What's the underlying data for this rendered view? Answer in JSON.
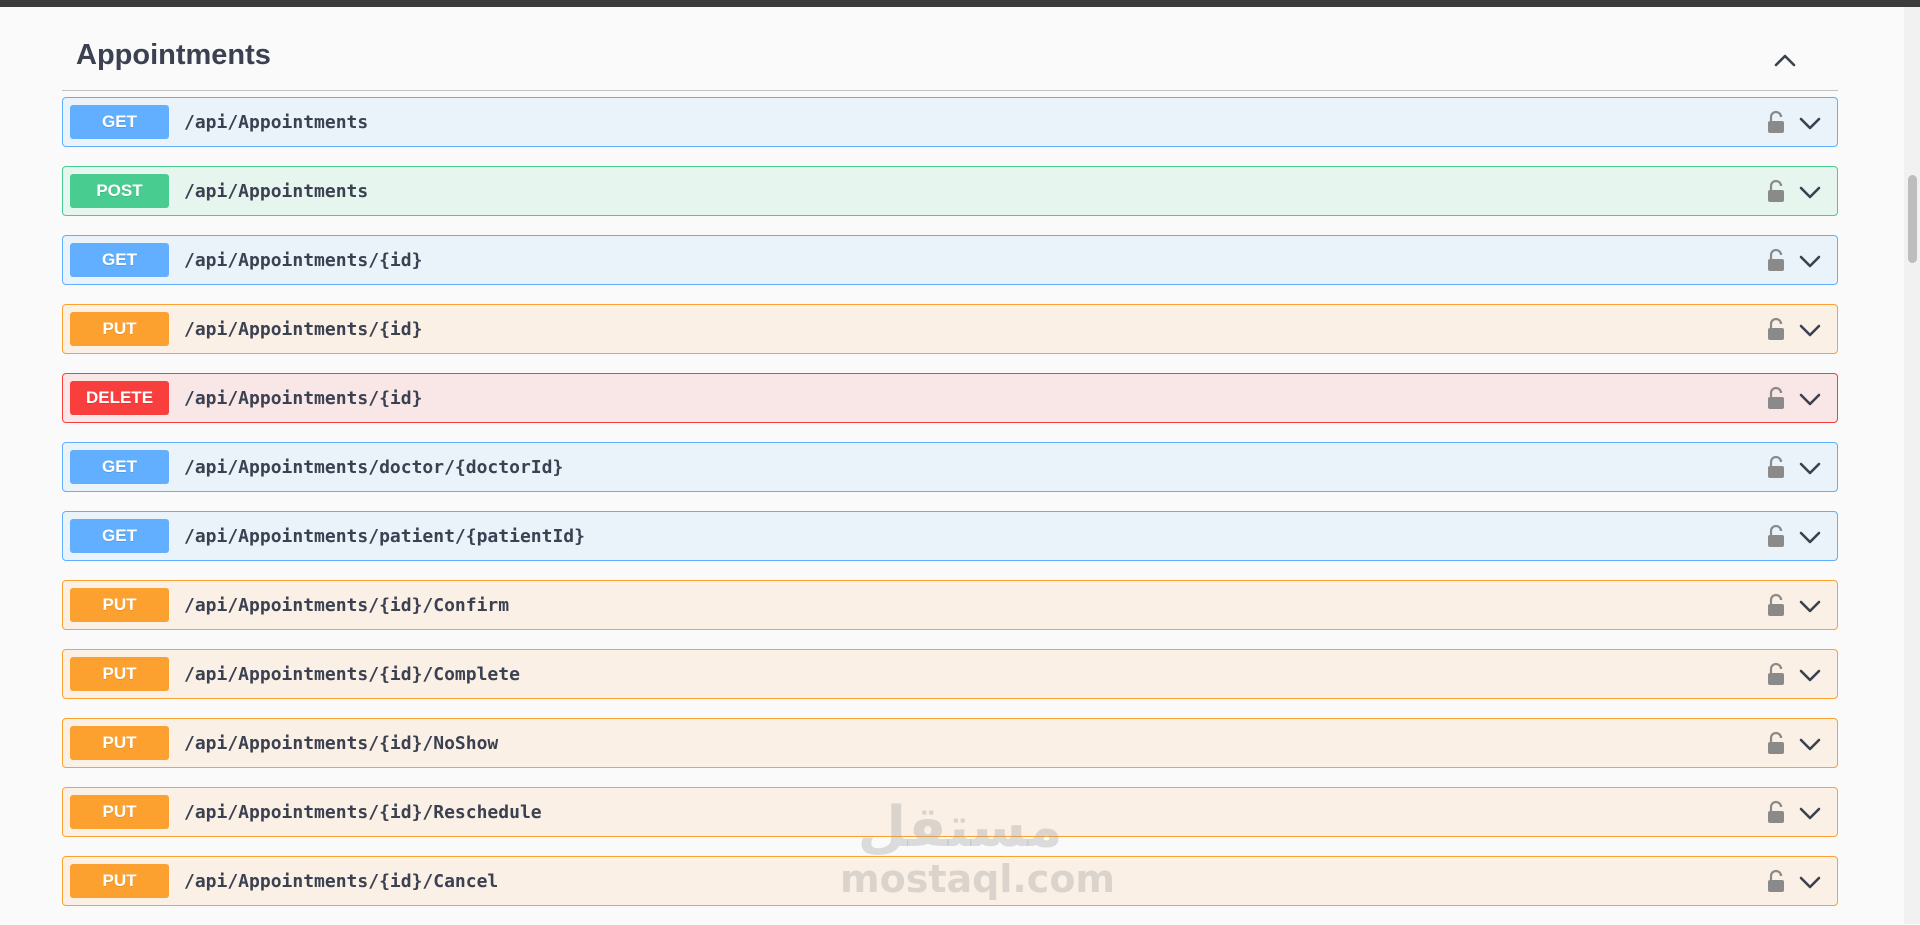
{
  "section": {
    "title": "Appointments",
    "toggle_icon": "chevron-up-icon"
  },
  "operations": [
    {
      "method": "GET",
      "path": "/api/Appointments"
    },
    {
      "method": "POST",
      "path": "/api/Appointments"
    },
    {
      "method": "GET",
      "path": "/api/Appointments/{id}"
    },
    {
      "method": "PUT",
      "path": "/api/Appointments/{id}"
    },
    {
      "method": "DELETE",
      "path": "/api/Appointments/{id}"
    },
    {
      "method": "GET",
      "path": "/api/Appointments/doctor/{doctorId}"
    },
    {
      "method": "GET",
      "path": "/api/Appointments/patient/{patientId}"
    },
    {
      "method": "PUT",
      "path": "/api/Appointments/{id}/Confirm"
    },
    {
      "method": "PUT",
      "path": "/api/Appointments/{id}/Complete"
    },
    {
      "method": "PUT",
      "path": "/api/Appointments/{id}/NoShow"
    },
    {
      "method": "PUT",
      "path": "/api/Appointments/{id}/Reschedule"
    },
    {
      "method": "PUT",
      "path": "/api/Appointments/{id}/Cancel"
    }
  ],
  "colors": {
    "GET": "#61affe",
    "POST": "#49cc90",
    "PUT": "#fca130",
    "DELETE": "#f93e3e",
    "text": "#3b4151"
  },
  "icons": {
    "lock": "lock-icon",
    "expand": "chevron-down-icon"
  },
  "watermark": {
    "arabic": "مستقل",
    "latin": "mostaql.com"
  }
}
